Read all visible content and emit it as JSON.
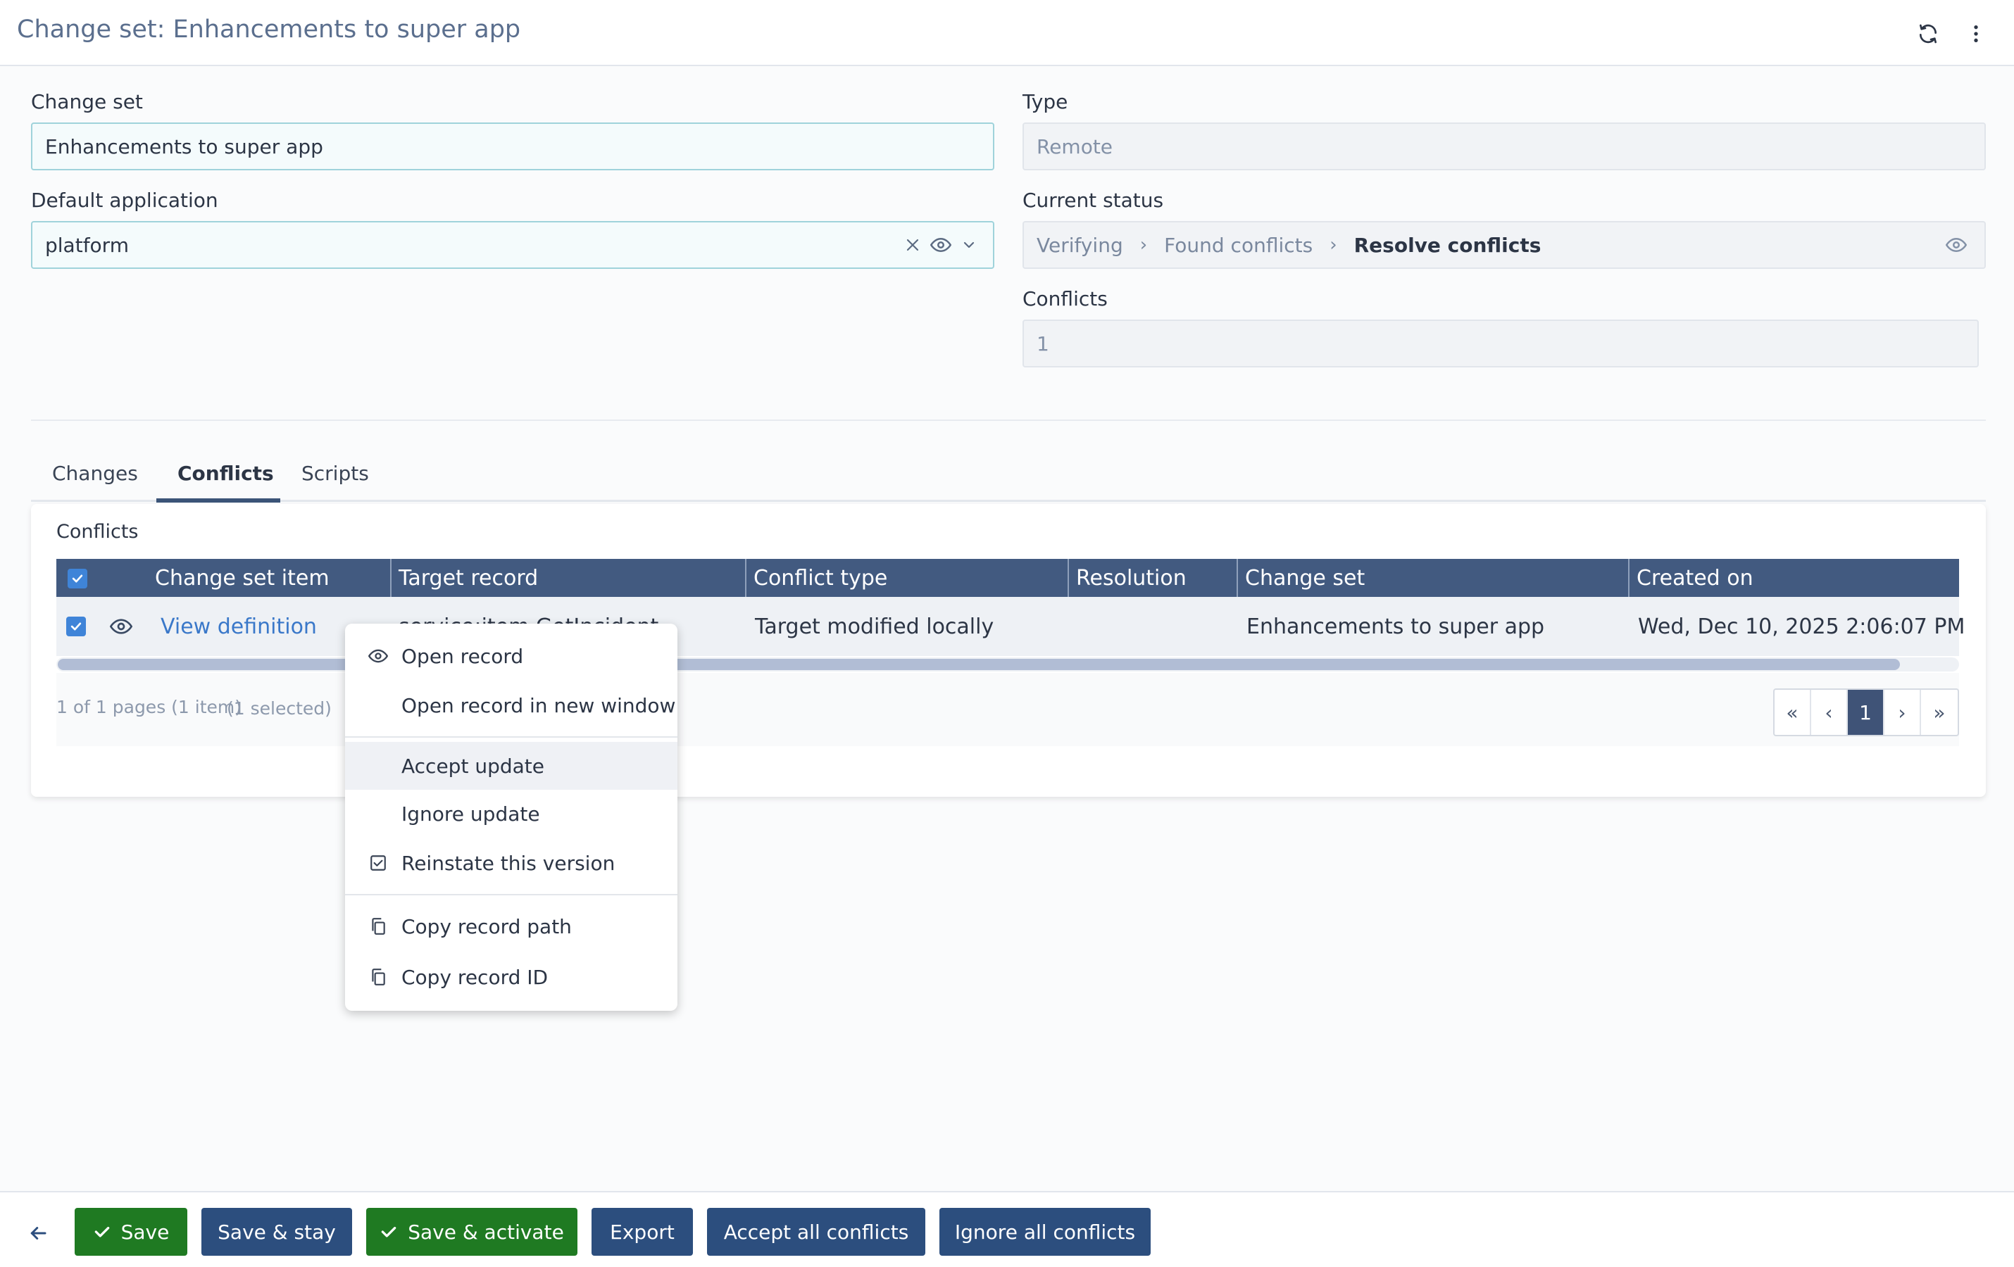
{
  "header": {
    "title": "Change set: Enhancements to super app",
    "refresh_icon": "refresh-icon",
    "more_icon": "more-vertical-icon"
  },
  "form": {
    "change_set": {
      "label": "Change set",
      "value": "Enhancements to super app"
    },
    "type": {
      "label": "Type",
      "value": "Remote"
    },
    "default_application": {
      "label": "Default application",
      "value": "platform"
    },
    "current_status": {
      "label": "Current status",
      "steps": [
        "Verifying",
        "Found conflicts",
        "Resolve conflicts"
      ],
      "separator": "›"
    },
    "conflicts": {
      "label": "Conflicts",
      "value": "1"
    }
  },
  "tabs": [
    {
      "label": "Changes"
    },
    {
      "label": "Conflicts",
      "active": true
    },
    {
      "label": "Scripts"
    }
  ],
  "grid": {
    "title": "Conflicts",
    "columns": [
      "Change set item",
      "Target record",
      "Conflict type",
      "Resolution",
      "Change set",
      "Created on"
    ],
    "rows": [
      {
        "change_set_item": "View definition",
        "target_record": "service:item.GetIncident",
        "conflict_type": "Target modified locally",
        "resolution": "",
        "change_set": "Enhancements to super app",
        "created_on": "Wed, Dec 10, 2025 2:06:07 PM"
      }
    ],
    "page_info": "1 of 1 pages (1 item)",
    "selected_info": "(1 selected)",
    "pager": {
      "first": "«",
      "prev": "‹",
      "current": "1",
      "next": "›",
      "last": "»"
    }
  },
  "context_menu": {
    "items": [
      {
        "label": "Open record",
        "icon": "eye-icon"
      },
      {
        "label": "Open record in new window",
        "icon": ""
      },
      {
        "label": "Accept update",
        "icon": ""
      },
      {
        "label": "Ignore update",
        "icon": ""
      },
      {
        "label": "Reinstate this version",
        "icon": "checkbox-icon"
      },
      {
        "label": "Copy record path",
        "icon": "copy-icon"
      },
      {
        "label": "Copy record ID",
        "icon": "copy-icon"
      }
    ]
  },
  "footer": {
    "back_icon": "arrow-left-icon",
    "buttons": [
      "Save",
      "Save & stay",
      "Save & activate",
      "Export",
      "Accept all conflicts",
      "Ignore all conflicts"
    ]
  },
  "colors": {
    "primary_blue": "#2c4e7e",
    "success_green": "#1f7a22",
    "table_header": "#425a80",
    "link": "#3a78c9"
  }
}
